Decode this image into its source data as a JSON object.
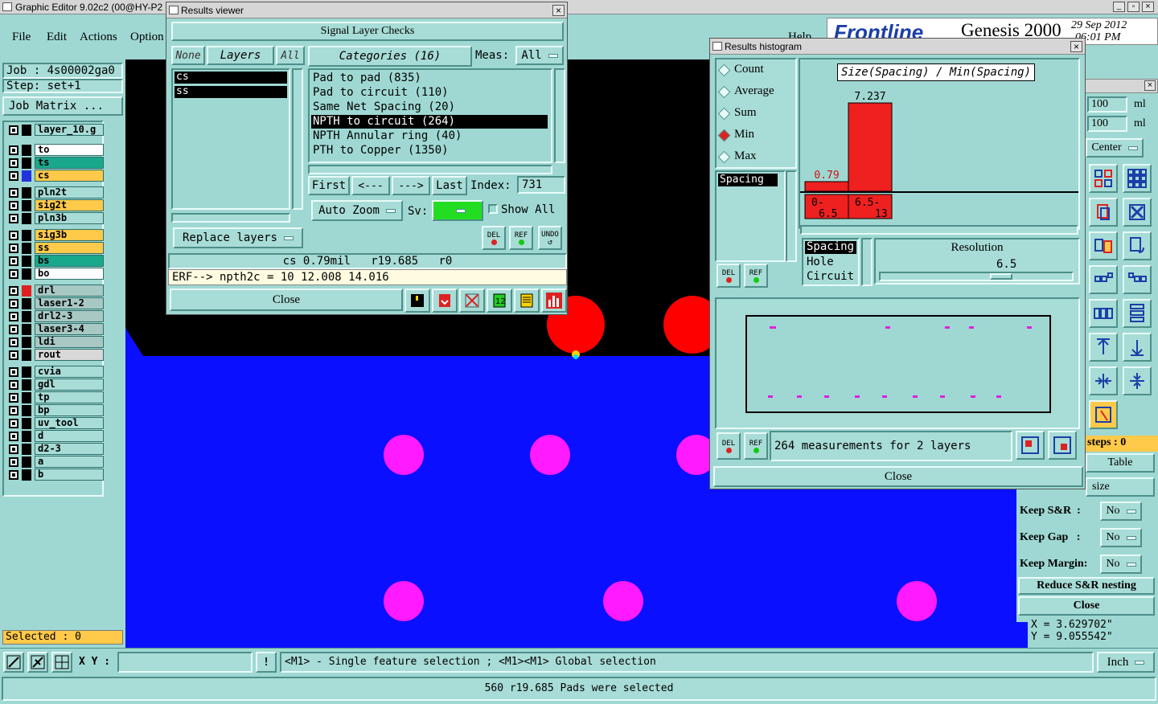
{
  "app": {
    "title": "Graphic Editor 9.02c2 (00@HY-P2",
    "menu": [
      "File",
      "Edit",
      "Actions",
      "Option"
    ],
    "help": "Help",
    "brand": "Frontline",
    "product": "Genesis 2000",
    "date": "29 Sep 2012",
    "time": "06:01 PM"
  },
  "left": {
    "job": "Job : 4s00002ga0",
    "step": "Step: set+1",
    "job_matrix": "Job Matrix ...",
    "selected": "Selected : 0",
    "layers": [
      {
        "name": "layer_10.g",
        "color": "#a8dcd6",
        "swatch": "#000"
      },
      {
        "name": "to",
        "color": "#ffffff",
        "swatch": "#000"
      },
      {
        "name": "ts",
        "color": "#1aa88c",
        "swatch": "#000"
      },
      {
        "name": "cs",
        "color": "#ffc94a",
        "swatch": "#2233dd"
      },
      {
        "name": "pln2t",
        "color": "#a8dcd6",
        "swatch": "#000"
      },
      {
        "name": "sig2t",
        "color": "#ffc94a",
        "swatch": "#000"
      },
      {
        "name": "pln3b",
        "color": "#a8dcd6",
        "swatch": "#000"
      },
      {
        "name": "sig3b",
        "color": "#ffc94a",
        "swatch": "#000"
      },
      {
        "name": "ss",
        "color": "#ffc94a",
        "swatch": "#000"
      },
      {
        "name": "bs",
        "color": "#1aa88c",
        "swatch": "#000"
      },
      {
        "name": "bo",
        "color": "#ffffff",
        "swatch": "#000"
      },
      {
        "name": "drl",
        "color": "#a8c8c4",
        "swatch": "#e02020"
      },
      {
        "name": "laser1-2",
        "color": "#a8c8c4",
        "swatch": "#000"
      },
      {
        "name": "drl2-3",
        "color": "#a8c8c4",
        "swatch": "#000"
      },
      {
        "name": "laser3-4",
        "color": "#a8c8c4",
        "swatch": "#000"
      },
      {
        "name": "ldi",
        "color": "#a8c8c4",
        "swatch": "#000"
      },
      {
        "name": "rout",
        "color": "#d8d8d8",
        "swatch": "#000"
      },
      {
        "name": "cvia",
        "color": "#a8dcd6",
        "swatch": "#000"
      },
      {
        "name": "gdl",
        "color": "#a8dcd6",
        "swatch": "#000"
      },
      {
        "name": "tp",
        "color": "#a8dcd6",
        "swatch": "#000"
      },
      {
        "name": "bp",
        "color": "#a8dcd6",
        "swatch": "#000"
      },
      {
        "name": "uv_tool",
        "color": "#a8dcd6",
        "swatch": "#000"
      },
      {
        "name": "d",
        "color": "#a8dcd6",
        "swatch": "#000"
      },
      {
        "name": "d2-3",
        "color": "#a8dcd6",
        "swatch": "#000"
      },
      {
        "name": "a",
        "color": "#a8dcd6",
        "swatch": "#000"
      },
      {
        "name": "b",
        "color": "#a8dcd6",
        "swatch": "#000"
      }
    ]
  },
  "results_viewer": {
    "title": "Results viewer",
    "header": "Signal Layer Checks",
    "none": "None",
    "layers_tab": "Layers",
    "all": "All",
    "categories": "Categories (16)",
    "meas_label": "Meas:",
    "meas_value": "All",
    "layer_list": [
      "cs",
      "ss"
    ],
    "category_list": [
      "Pad to pad (835)",
      "Pad to circuit (110)",
      "Same Net Spacing (20)",
      "NPTH to circuit (264)",
      "NPTH Annular ring (40)",
      "PTH to Copper (1350)"
    ],
    "selected_category": "NPTH to circuit (264)",
    "first": "First",
    "prev": "<---",
    "next": "--->",
    "last": "Last",
    "index_label": "Index:",
    "index_value": "731",
    "auto_zoom": "Auto Zoom",
    "sv_label": "Sv:",
    "show_all": "Show All",
    "replace_layers": "Replace layers",
    "del": "DEL",
    "ref": "REF",
    "undo": "UNDO",
    "info": "cs 0.79mil   r19.685   r0",
    "erf": "ERF--> npth2c = 10 12.008 14.016",
    "close": "Close"
  },
  "histogram": {
    "title": "Results histogram",
    "options": [
      "Count",
      "Average",
      "Sum",
      "Min",
      "Max"
    ],
    "selected_option": "Min",
    "chart_title": "Size(Spacing) / Min(Spacing)",
    "list_items": [
      "Spacing"
    ],
    "del": "DEL",
    "ref": "REF",
    "measures": [
      "Spacing",
      "Hole",
      "Circuit"
    ],
    "resolution_label": "Resolution",
    "resolution_value": "6.5",
    "summary": "264 measurements for 2 layers",
    "close": "Close",
    "chart_data": {
      "type": "bar",
      "categories": [
        "0-6.5",
        "6.5-13"
      ],
      "values": [
        0.79,
        7.237
      ],
      "value_labels": [
        "0.79",
        "7.237"
      ],
      "category_labels": [
        [
          "0-",
          "6.5"
        ],
        [
          "6.5-",
          "13"
        ]
      ],
      "ylim": [
        0,
        7.9
      ],
      "bar_color": "#ee2020",
      "label_color_low": "#cc1111",
      "label_color_high": "#000000"
    }
  },
  "right_panel": {
    "fields": [
      "100",
      "100"
    ],
    "units": [
      "ml",
      "ml"
    ],
    "center": "Center",
    "steps": "steps : 0",
    "table": "Table",
    "size": "size",
    "keep_sr": "Keep S&R  :",
    "keep_gap": "Keep Gap   :",
    "keep_margin": "Keep Margin:",
    "no": "No",
    "reduce": "Reduce S&R nesting",
    "close": "Close",
    "x_coord": "X = 3.629702\"",
    "y_coord": "Y = 9.055542\""
  },
  "bottom": {
    "xy_label": "X Y :",
    "xy_value": "",
    "hint": "<M1> - Single feature selection ; <M1><M1> Global selection",
    "unit": "Inch",
    "status": "560 r19.685 Pads were selected"
  },
  "colors": {
    "panel": "#a8dcd6",
    "canvas_blue": "#0a10ff",
    "pad_magenta": "#ff1aff",
    "pad_red": "#ff0000",
    "marker_magenta": "#e020e0"
  }
}
